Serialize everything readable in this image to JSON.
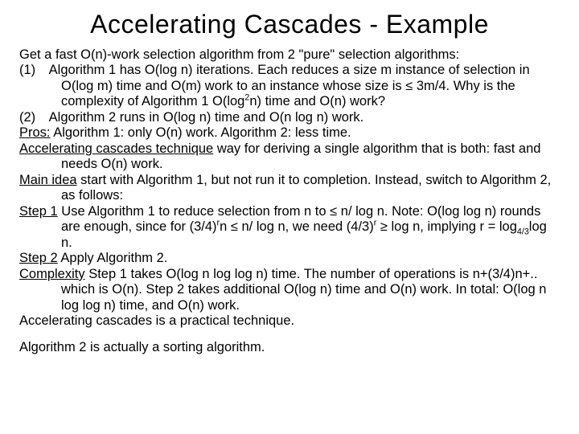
{
  "title": "Accelerating Cascades - Example",
  "lines": {
    "intro": "Get a fast O(n)-work selection algorithm from 2 \"pure\" selection algorithms:",
    "item1_lead": "(1) ",
    "item1_a": "Algorithm 1 has O(log n) iterations. Each reduces a size m instance of selection in O(log m) time and O(m) work to an instance whose size is ≤ 3m/4.  Why is the complexity of Algorithm 1 O(log",
    "item1_b": "n) time and O(n) work?",
    "item2_lead": "(2) ",
    "item2": "Algorithm 2 runs in O(log n) time and O(n log n) work.",
    "pros_label": "Pros:",
    "pros_text": "  Algorithm 1: only O(n) work. Algorithm 2: less time.",
    "acc_label": "Accelerating cascades technique",
    "acc_text": " way for deriving a single algorithm that is both: fast and needs O(n) work.",
    "main_label": "Main idea",
    "main_text": " start with Algorithm 1, but not run it to completion. Instead, switch to Algorithm 2, as follows:",
    "step1_label": "Step 1",
    "step1_a": " Use Algorithm 1 to reduce selection from n to ≤ n/ log n. Note: O(log log n) rounds are enough, since for (3/4)",
    "step1_b": "n ≤ n/ log n,  we need (4/3)",
    "step1_c": " ≥ log n, implying r = log",
    "step1_d": "log n.",
    "step2_label": "Step 2",
    "step2_text": " Apply Algorithm 2.",
    "comp_label": "Complexity",
    "comp_text": " Step 1 takes O(log n log log n) time. The number of operations is n+(3/4)n+.. which is O(n). Step 2 takes additional O(log n) time and O(n) work. In total: O(log n log log n) time, and O(n) work.",
    "practical": "Accelerating cascades is a practical technique.",
    "footer": "Algorithm 2 is actually a sorting algorithm.",
    "sup2": "2",
    "supr": "r",
    "sub43": "4/3"
  }
}
